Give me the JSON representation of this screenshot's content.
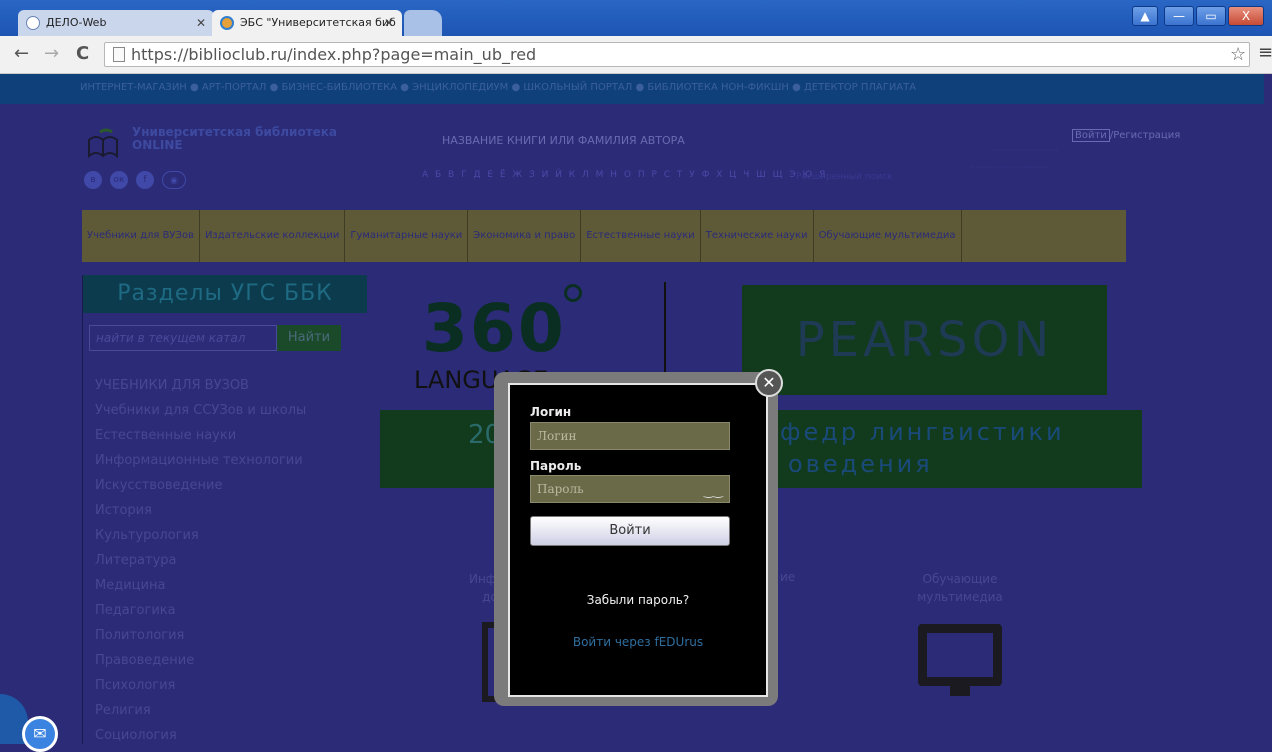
{
  "browser": {
    "tabs": [
      {
        "label": "ДЕЛО-Web"
      },
      {
        "label": "ЭБС \"Университетская биб"
      }
    ],
    "window_controls": {
      "minimize": "—",
      "maximize": "▭",
      "close": "X",
      "user": "▲"
    },
    "url_host": "https://biblioclub.ru",
    "url_path": "/index.php?page=main_ub_red"
  },
  "site": {
    "top_nav": "ИНТЕРНЕТ-МАГАЗИН ● АРТ-ПОРТАЛ ● БИЗНЕС-БИБЛИОТЕКА ● ЭНЦИКЛОПЕДИУМ ● ШКОЛЬНЫЙ ПОРТАЛ ● БИБЛИОТЕКА НОН-ФИКШН ● ДЕТЕКТОР ПЛАГИАТА",
    "logo_title": "Университетская библиотека ONLINE",
    "search_placeholder": "НАЗВАНИЕ КНИГИ ИЛИ ФАМИЛИЯ АВТОРА",
    "alphabet": "А Б В Г Д Е Ё Ж З И Й К Л М Н О П Р С Т У Ф Х Ц Ч Ш Щ Э Ю Я",
    "advanced_search": "Расширенный поиск",
    "login_label": "Войти",
    "register_label": "Регистрация",
    "categories": [
      "Учебники для ВУЗов",
      "Издательские коллекции",
      "Гуманитарные науки",
      "Экономика и право",
      "Естественные науки",
      "Технические науки",
      "Обучающие мультимедиа"
    ],
    "sidebar": {
      "heading": "Разделы УГС ББК",
      "search_placeholder": "найти в текущем катал",
      "search_button": "Найти",
      "items": [
        "УЧЕБНИКИ ДЛЯ ВУЗОВ",
        "Учебники для ССУЗов и школы",
        "Естественные науки",
        "Информационные технологии",
        "Искусствоведение",
        "История",
        "Культурология",
        "Литература",
        "Медицина",
        "Педагогика",
        "Политология",
        "Правоведение",
        "Психология",
        "Религия",
        "Социология"
      ]
    },
    "banner": {
      "number": "360",
      "language": "LANGUAGE",
      "pearson": "PEARSON",
      "band_left": "20",
      "band_right_1": "федр лингвистики",
      "band_right_2": "оведения"
    },
    "features": {
      "left": "Инфор до",
      "right": "ие",
      "multimedia": "Обучающие мультимедиа"
    }
  },
  "modal": {
    "login_label": "Логин",
    "login_placeholder": "Логин",
    "password_label": "Пароль",
    "password_placeholder": "Пароль",
    "submit": "Войти",
    "forgot": "Забыли пароль?",
    "fedurus": "Войти через fEDUrus"
  }
}
